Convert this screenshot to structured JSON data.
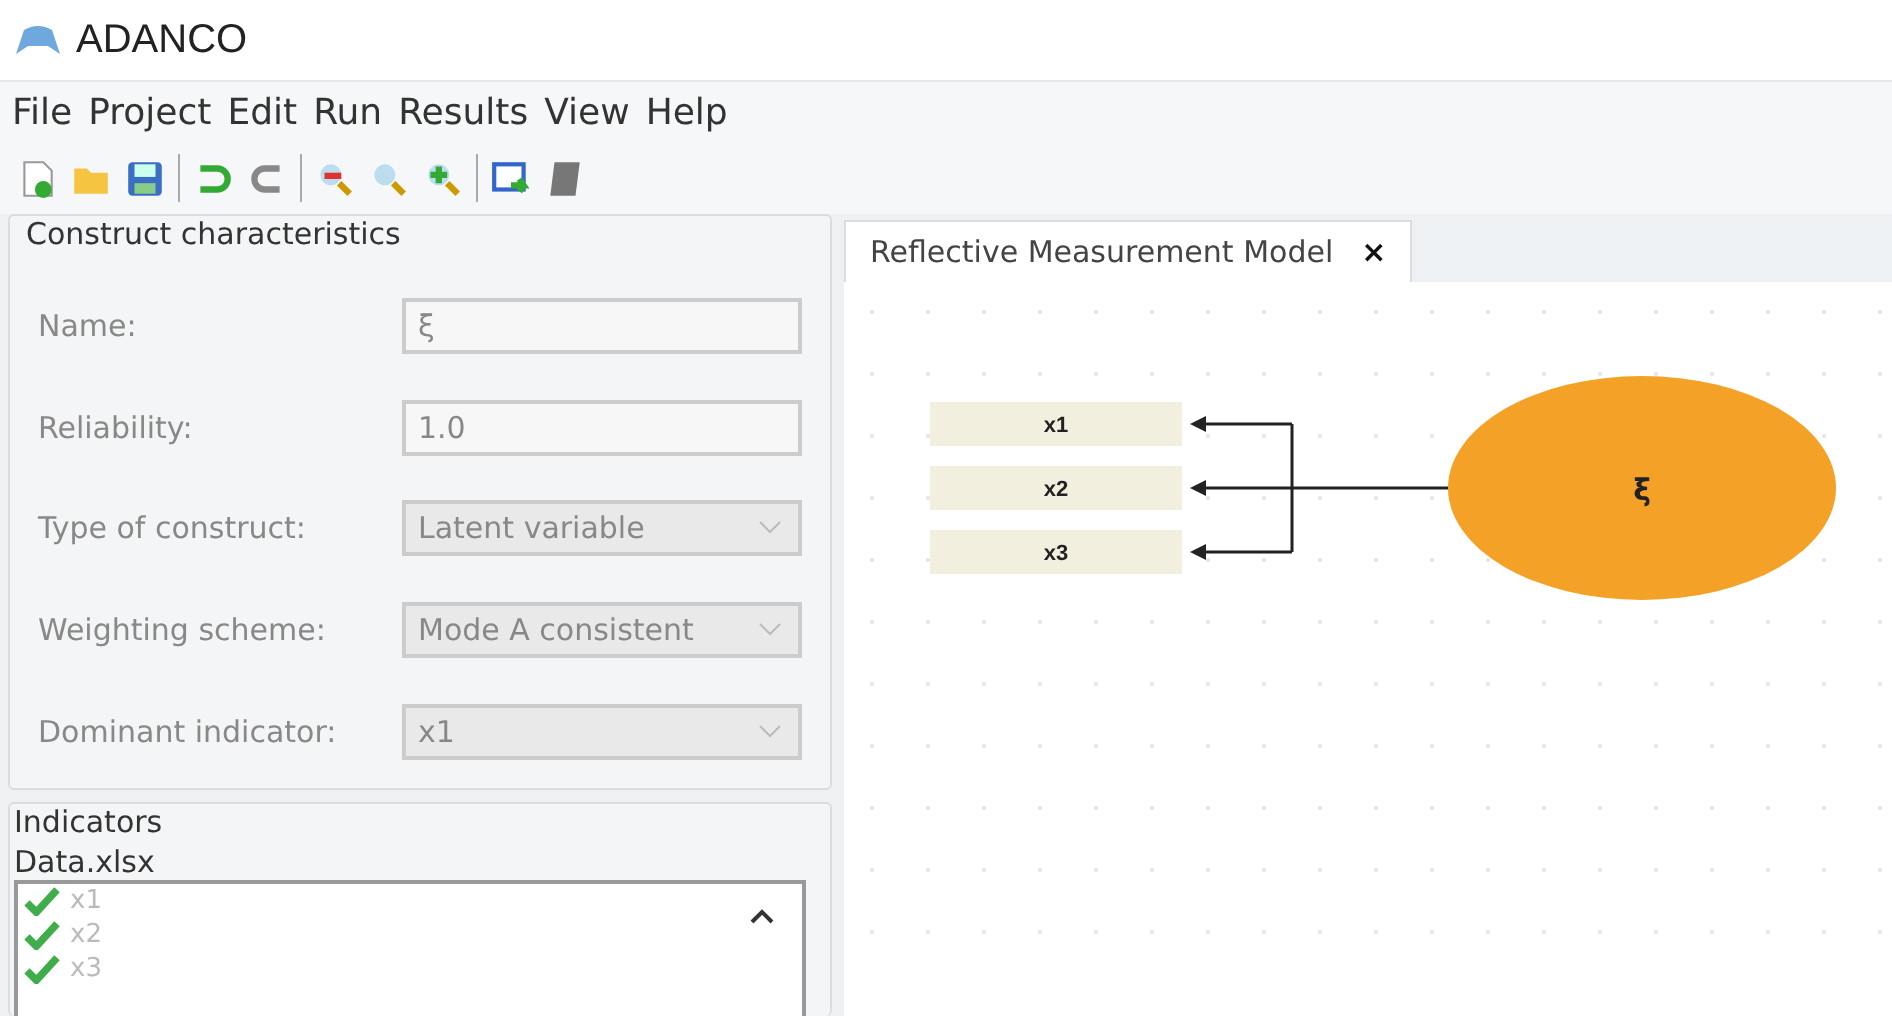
{
  "window": {
    "title": "ADANCO"
  },
  "menu": [
    "File",
    "Project",
    "Edit",
    "Run",
    "Results",
    "View",
    "Help"
  ],
  "toolbar": [
    {
      "kind": "new"
    },
    {
      "kind": "open"
    },
    {
      "kind": "save"
    },
    {
      "kind": "sep"
    },
    {
      "kind": "undo"
    },
    {
      "kind": "redo"
    },
    {
      "kind": "sep"
    },
    {
      "kind": "zoom-out"
    },
    {
      "kind": "zoom"
    },
    {
      "kind": "zoom-in"
    },
    {
      "kind": "sep"
    },
    {
      "kind": "export"
    },
    {
      "kind": "script"
    }
  ],
  "construct": {
    "title": "Construct characteristics",
    "fields": [
      {
        "label": "Name:",
        "kind": "text",
        "value": "ξ",
        "disabled": true
      },
      {
        "label": "Reliability:",
        "kind": "text",
        "value": "1.0",
        "disabled": true
      },
      {
        "label": "Type of construct:",
        "kind": "dropdown",
        "value": "Latent variable",
        "disabled": true
      },
      {
        "label": "Weighting scheme:",
        "kind": "dropdown",
        "value": "Mode A consistent",
        "disabled": true
      },
      {
        "label": "Dominant indicator:",
        "kind": "dropdown",
        "value": "x1",
        "disabled": true
      }
    ]
  },
  "indicators": {
    "title": "Indicators",
    "file": "Data.xlsx",
    "items": [
      {
        "label": "x1",
        "checked": true
      },
      {
        "label": "x2",
        "checked": true
      },
      {
        "label": "x3",
        "checked": true
      }
    ]
  },
  "tabs": [
    {
      "label": "Reflective Measurement Model",
      "close": "×",
      "selected": true
    }
  ],
  "diagram": {
    "indicators": [
      "x1",
      "x2",
      "x3"
    ],
    "construct": "ξ"
  }
}
